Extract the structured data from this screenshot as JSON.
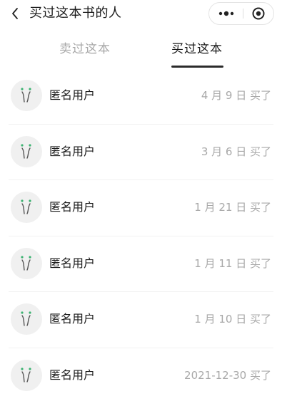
{
  "header": {
    "title": "买过这本书的人",
    "back_icon": "chevron-left-icon",
    "more_icon": "more-dots-icon",
    "close_icon": "target-circle-icon"
  },
  "tabs": [
    {
      "label": "卖过这本",
      "active": false
    },
    {
      "label": "买过这本",
      "active": true
    }
  ],
  "buyers": [
    {
      "name": "匿名用户",
      "date": "4 月 9 日 买了"
    },
    {
      "name": "匿名用户",
      "date": "3 月 6 日 买了"
    },
    {
      "name": "匿名用户",
      "date": "1 月 21 日 买了"
    },
    {
      "name": "匿名用户",
      "date": "1 月 11 日 买了"
    },
    {
      "name": "匿名用户",
      "date": "1 月 10 日 买了"
    },
    {
      "name": "匿名用户",
      "date": "2021-12-30 买了"
    }
  ],
  "colors": {
    "avatar_bg": "#f0f0f0",
    "avatar_accent": "#3cb371",
    "muted_text": "#a8a8a8"
  }
}
